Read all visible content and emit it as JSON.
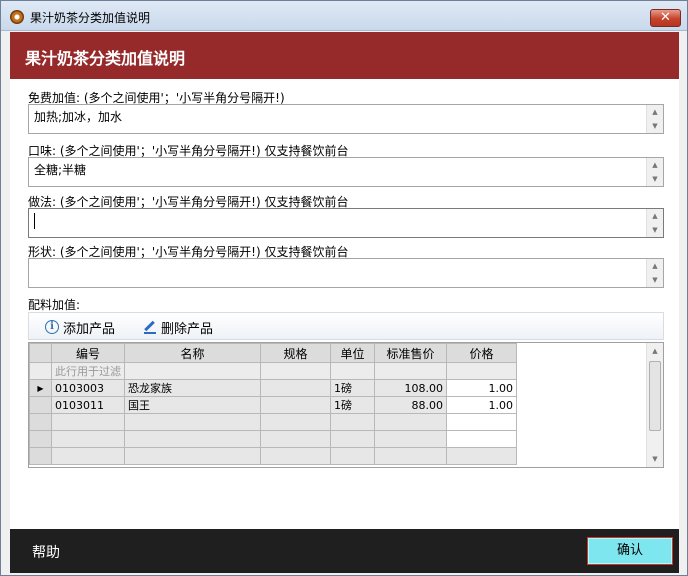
{
  "window": {
    "title": "果汁奶茶分类加值说明",
    "close_glyph": "✕"
  },
  "banner": {
    "title": "果汁奶茶分类加值说明"
  },
  "fields": [
    {
      "label": "免费加值: (多个之间使用'；'小写半角分号隔开!)",
      "value": "加热;加冰，加水"
    },
    {
      "label": "口味: (多个之间使用'；'小写半角分号隔开!) 仅支持餐饮前台",
      "value": "全糖;半糖"
    },
    {
      "label": "做法: (多个之间使用'；'小写半角分号隔开!) 仅支持餐饮前台",
      "value": ""
    },
    {
      "label": "形状: (多个之间使用'；'小写半角分号隔开!) 仅支持餐饮前台",
      "value": ""
    }
  ],
  "addons": {
    "label": "配料加值:",
    "toolbar": {
      "add_label": "添加产品",
      "delete_label": "删除产品"
    },
    "columns": [
      "编号",
      "名称",
      "规格",
      "单位",
      "标准售价",
      "价格"
    ],
    "filter_text": "此行用于过滤",
    "rows": [
      {
        "code": "0103003",
        "name": "恐龙家族",
        "spec": "",
        "unit": "1磅",
        "std_price": "108.00",
        "price": "1.00"
      },
      {
        "code": "0103011",
        "name": "国王",
        "spec": "",
        "unit": "1磅",
        "std_price": "88.00",
        "price": "1.00"
      }
    ]
  },
  "footer": {
    "help_label": "帮助",
    "ok_label": "确认"
  }
}
